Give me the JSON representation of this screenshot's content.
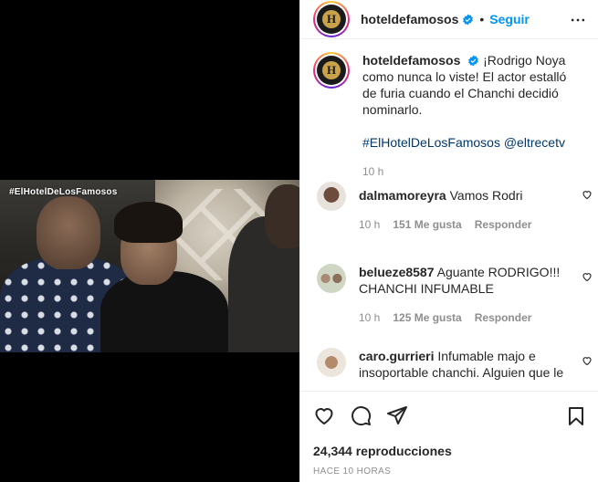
{
  "post": {
    "username": "hoteldefamosos",
    "follow_label": "Seguir",
    "separator": "•",
    "avatar_letter": "H",
    "video_overlay_tag": "#ElHotelDeLosFamosos",
    "caption": {
      "username": "hoteldefamosos",
      "text": "¡Rodrigo Noya como nunca lo viste! El actor estalló de furia cuando el Chanchi decidió nominarlo.",
      "tags": "#ElHotelDeLosFamosos @eltrecetv",
      "time": "10 h"
    },
    "comments": [
      {
        "username": "dalmamoreyra",
        "text": "Vamos Rodri",
        "time": "10 h",
        "likes": "151 Me gusta",
        "reply": "Responder"
      },
      {
        "username": "belueze8587",
        "text": "Aguante RODRIGO!!! CHANCHI INFUMABLE",
        "time": "10 h",
        "likes": "125 Me gusta",
        "reply": "Responder"
      },
      {
        "username": "caro.gurrieri",
        "text": "Infumable majo e insoportable chanchi. Alguien que le"
      }
    ],
    "views": "24,344 reproducciones",
    "timestamp": "HACE 10 HORAS"
  },
  "colors": {
    "link": "#0095f6",
    "hashtag": "#00376b",
    "muted": "#8e8e8e",
    "verified": "#0095f6"
  },
  "icons": [
    "heart-icon",
    "comment-icon",
    "share-icon",
    "save-icon",
    "more-options-icon",
    "verified-badge-icon"
  ]
}
